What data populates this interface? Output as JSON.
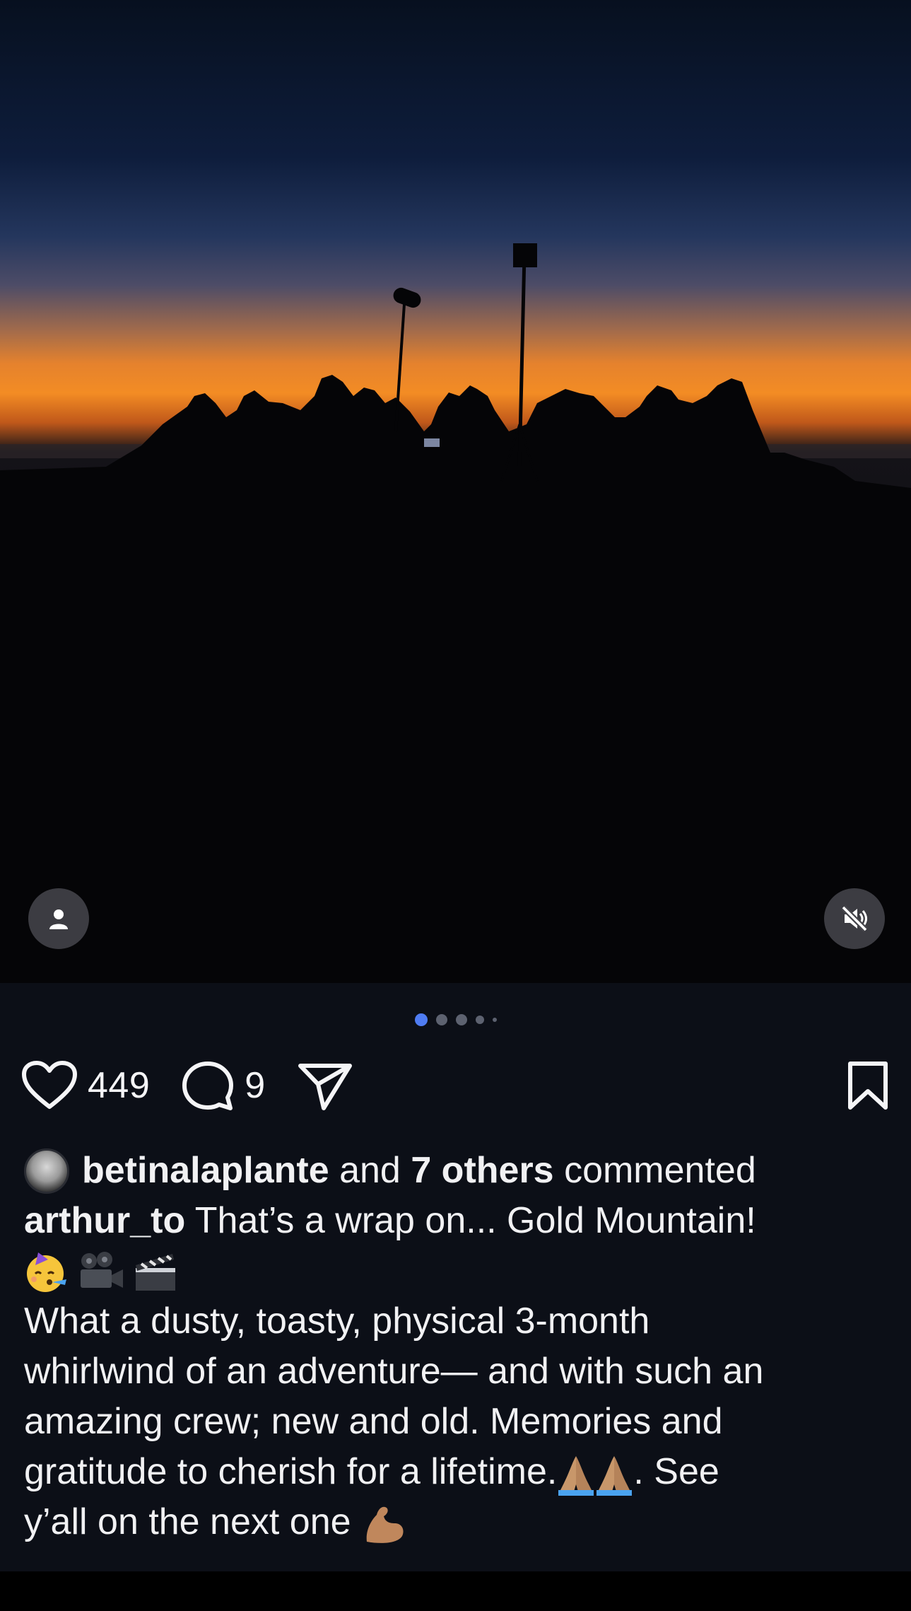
{
  "media": {
    "tag_icon": "person-tag-icon",
    "mute_icon": "speaker-muted-icon",
    "carousel": {
      "count": 5,
      "active_index": 0
    }
  },
  "actions": {
    "like_icon": "heart-icon",
    "likes": "449",
    "comment_icon": "comment-bubble-icon",
    "comments": "9",
    "share_icon": "paper-plane-icon",
    "save_icon": "bookmark-icon"
  },
  "commented": {
    "user": "betinalaplante",
    "and": "and",
    "others": "7 others",
    "suffix": "commented"
  },
  "caption": {
    "author": "arthur_to",
    "first_line": "That’s a wrap on... Gold Mountain!",
    "line_1": "What a dusty, toasty, physical 3-month",
    "line_2": "whirlwind of an adventure— and with such an",
    "line_3": "amazing crew; new and old. Memories and",
    "line_4a": "gratitude to cherish for a lifetime.",
    "line_4b": ". See",
    "line_5": "y’all on the next one"
  },
  "colors": {
    "background": "#0c0f17",
    "accent_dot": "#4f7cf2",
    "text": "#f5f5f7"
  }
}
